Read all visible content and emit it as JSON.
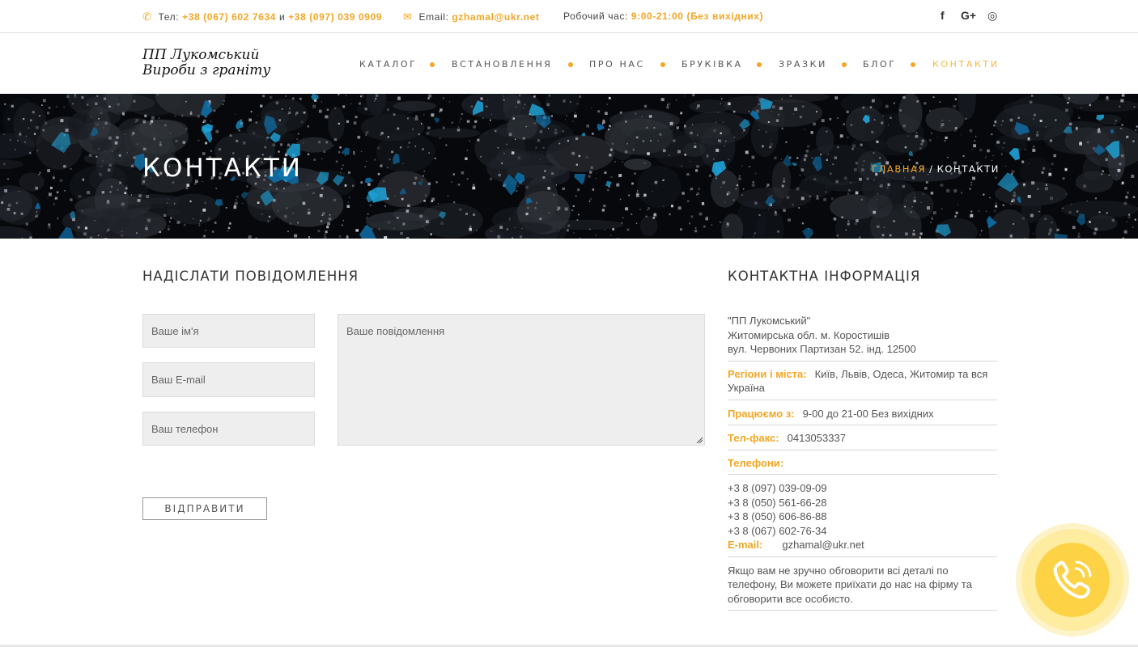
{
  "topbar": {
    "phone_label": "Тел:",
    "phone1": "+38 (067) 602 7634",
    "phone_join": "и",
    "phone2": "+38 (097) 039 0909",
    "email_label": "Email:",
    "email": "gzhamal@ukr.net",
    "hours_label": "Робочий час:",
    "hours": "9:00-21:00 (Без вихідних)",
    "social": [
      "facebook-icon",
      "google-plus-icon",
      "instagram-icon"
    ],
    "social_glyphs": [
      "f",
      "G+",
      "◎"
    ]
  },
  "logo": {
    "line1": "ПП Лукомський",
    "line2": "Вироби з граніту"
  },
  "nav": {
    "items": [
      "КАТАЛОГ",
      "ВСТАНОВЛЕННЯ",
      "ПРО НАС",
      "БРУКІВКА",
      "ЗРАЗКИ",
      "БЛОГ",
      "КОНТАКТИ"
    ],
    "active_index": 6
  },
  "banner": {
    "title": "КОНТАКТИ",
    "breadcrumb_home": "ГЛАВНАЯ",
    "breadcrumb_sep": "/",
    "breadcrumb_current": "КОНТАКТИ"
  },
  "form": {
    "title": "НАДІСЛАТИ ПОВІДОМЛЕННЯ",
    "name_placeholder": "Ваше ім'я",
    "email_placeholder": "Ваш E-mail",
    "phone_placeholder": "Ваш телефон",
    "message_placeholder": "Ваше повідомлення",
    "submit_label": "ВІДПРАВИТИ"
  },
  "contact": {
    "title": "КОНТАКТНА ІНФОРМАЦІЯ",
    "company": "\"ПП Лукомський\"",
    "address1": "Житомирська обл. м. Коростишів",
    "address2": "вул. Червоних Партизан 52. інд. 12500",
    "regions_label": "Регіони і міста:",
    "regions": "Київ, Львів, Одеса, Житомир та вся Україна",
    "work_label": "Працюємо з:",
    "work": "9-00 до 21-00 Без вихідних",
    "fax_label": "Тел-факс:",
    "fax": "0413053337",
    "phones_label": "Телефони:",
    "phones": [
      "+3 8 (097) 039-09-09",
      "+3 8 (050) 561-66-28",
      "+3 8 (050) 606-86-88",
      "+3 8 (067) 602-76-34"
    ],
    "email_label": "E-mail:",
    "email": "gzhamal@ukr.net",
    "note": "Якщо вам не зручно обговорити всі деталі по телефону, Ви можете приїхати до нас на фірму та обговорити все особисто."
  },
  "colors": {
    "accent": "#f5a623",
    "call_button": "#fdd245"
  },
  "call_widget": {
    "icon": "phone-ringing-icon"
  }
}
